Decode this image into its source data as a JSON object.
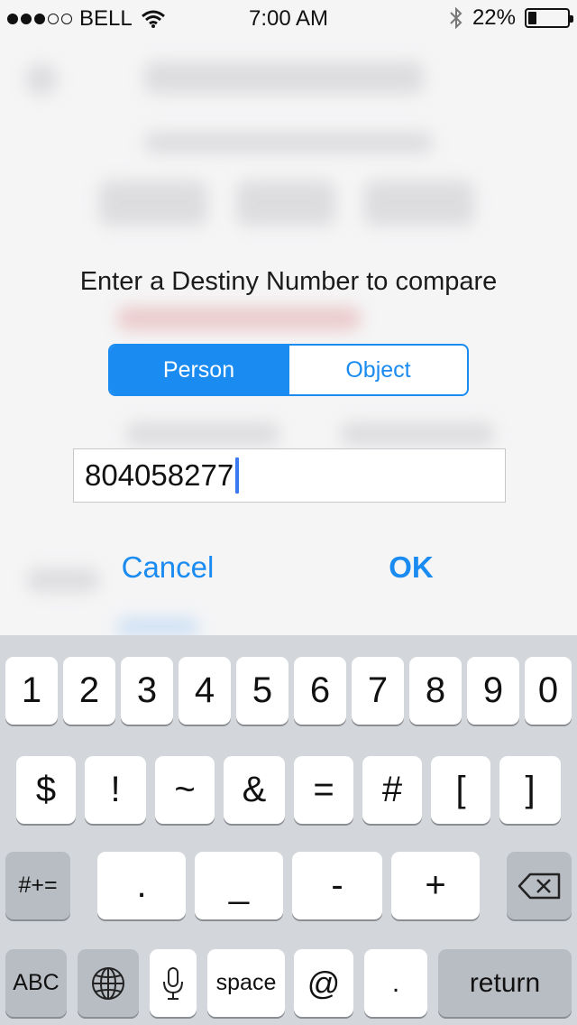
{
  "status_bar": {
    "carrier": "BELL",
    "time": "7:00 AM",
    "battery_percent_label": "22%",
    "battery_level": 0.22,
    "signal_bars_filled": 3,
    "signal_bars_total": 5
  },
  "dialog": {
    "prompt": "Enter a Destiny Number to compare",
    "segments": [
      "Person",
      "Object"
    ],
    "selected_segment": "Person",
    "input_value": "804058277",
    "cancel_label": "Cancel",
    "ok_label": "OK"
  },
  "keyboard": {
    "row1": [
      "1",
      "2",
      "3",
      "4",
      "5",
      "6",
      "7",
      "8",
      "9",
      "0"
    ],
    "row2": [
      "$",
      "!",
      "~",
      "&",
      "=",
      "#",
      "[",
      "]"
    ],
    "row3_shift": "#+=",
    "row3": [
      ".",
      "_",
      "-",
      "+"
    ],
    "row4": {
      "abc": "ABC",
      "space": "space",
      "at": "@",
      "dot": ".",
      "return": "return"
    }
  },
  "colors": {
    "accent": "#1a8bf0",
    "caret": "#3a7bf2",
    "keyboard_bg": "#d3d6db",
    "function_key": "#b8bcc3"
  }
}
